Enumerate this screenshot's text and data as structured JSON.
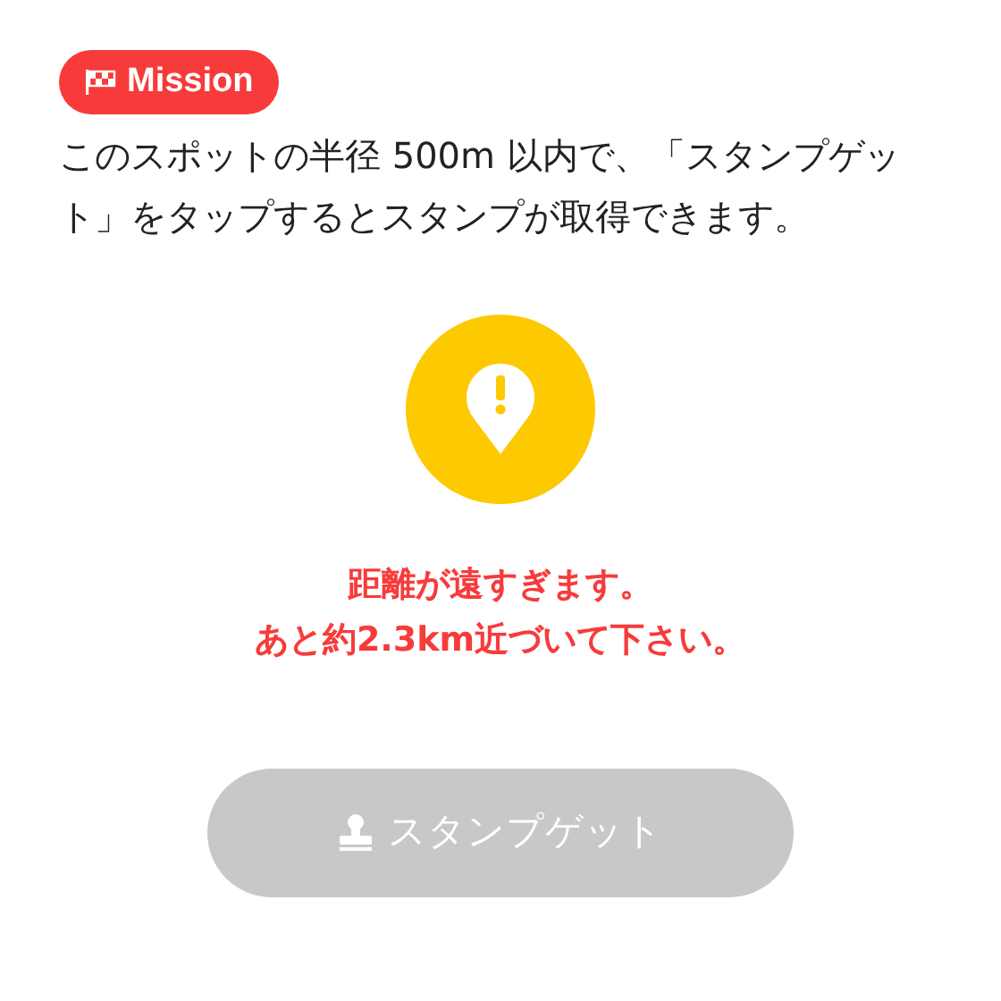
{
  "mission_badge": {
    "label": "Mission"
  },
  "description": "このスポットの半径 500m 以内で、「スタンプゲット」をタップするとスタンプが取得できます。",
  "warning": {
    "lines": [
      "距離が遠すぎます。",
      "あと約2.3km近づいて下さい。"
    ]
  },
  "stamp_button": {
    "label": "スタンプゲット",
    "disabled": true
  }
}
